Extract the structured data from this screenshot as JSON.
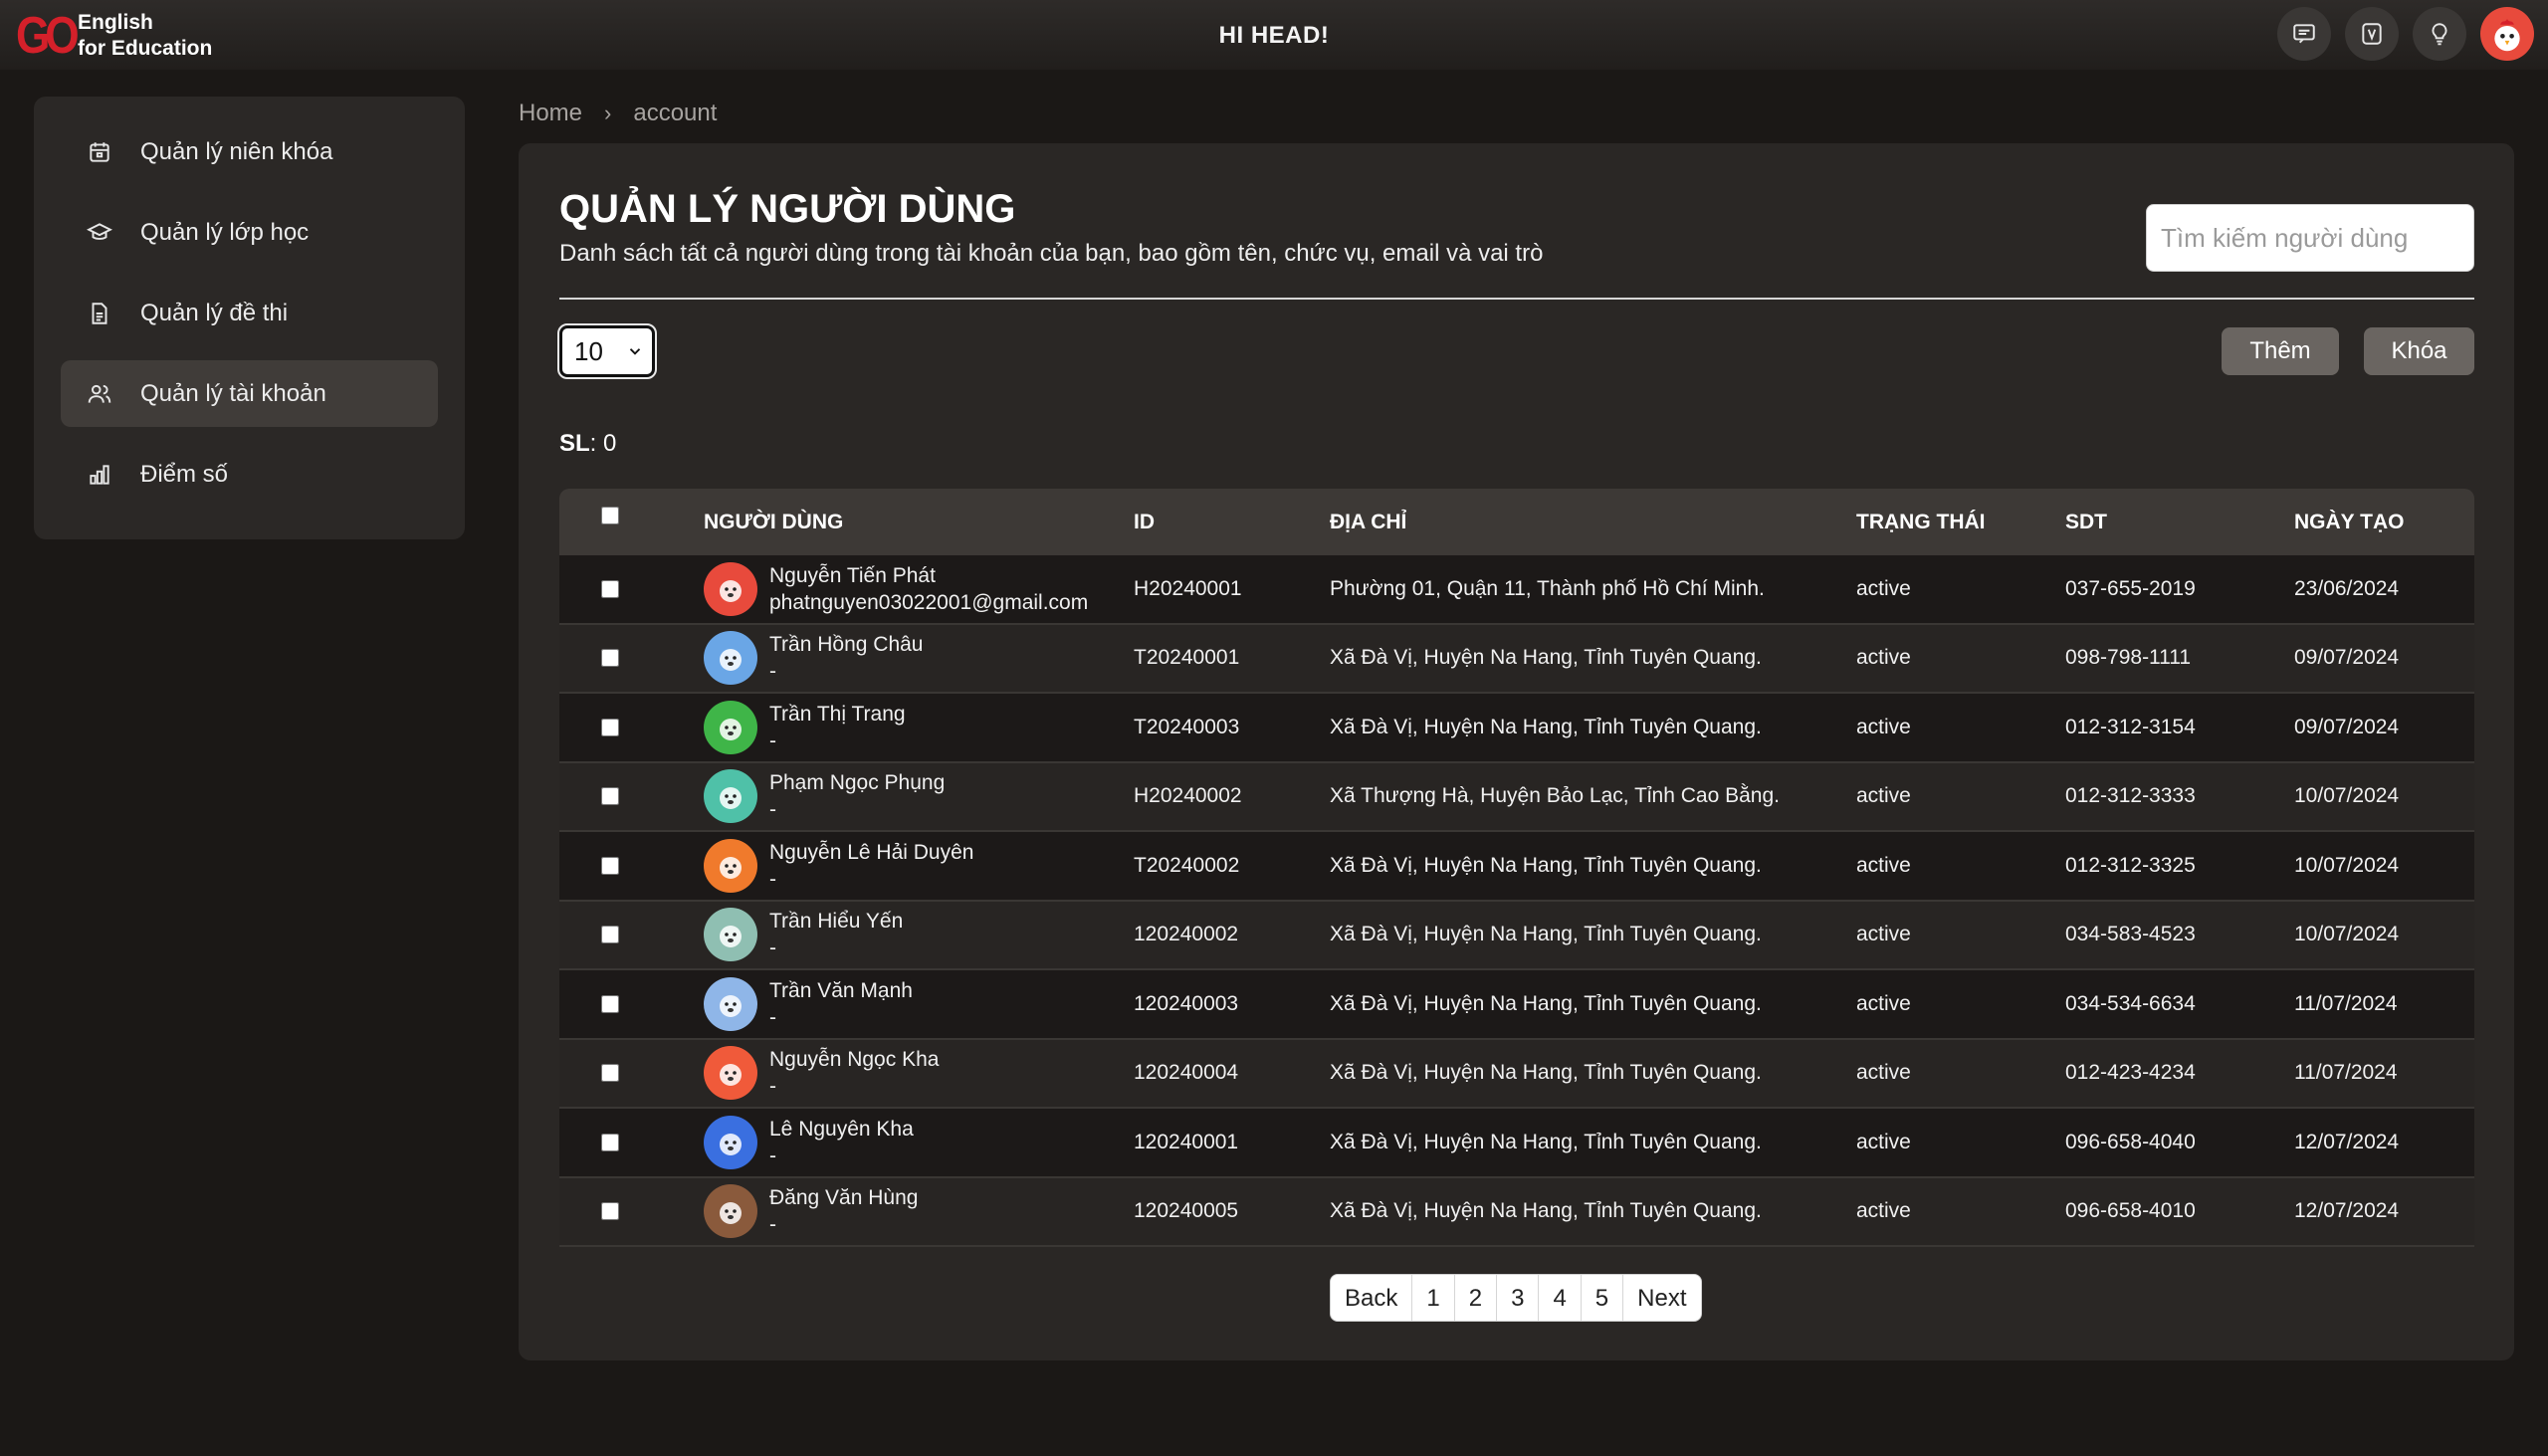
{
  "brand": {
    "mark": "GO",
    "line1": "English",
    "line2": "for Education"
  },
  "header": {
    "title": "HI HEAD!",
    "icons": [
      "chat-icon",
      "v-badge-icon",
      "lightbulb-icon",
      "user-avatar"
    ]
  },
  "sidebar": {
    "items": [
      {
        "label": "Quản lý niên khóa",
        "icon": "calendar-icon"
      },
      {
        "label": "Quản lý lớp học",
        "icon": "graduation-cap-icon"
      },
      {
        "label": "Quản lý đề thi",
        "icon": "document-icon"
      },
      {
        "label": "Quản lý tài khoản",
        "icon": "users-icon",
        "active": true
      },
      {
        "label": "Điểm số",
        "icon": "bar-chart-icon"
      }
    ]
  },
  "breadcrumb": {
    "home": "Home",
    "separator": "›",
    "current": "account"
  },
  "main": {
    "title": "QUẢN LÝ NGƯỜI DÙNG",
    "subtitle": "Danh sách tất cả người dùng trong tài khoản của bạn, bao gồm tên, chức vụ, email và vai trò",
    "search_placeholder": "Tìm kiếm người dùng",
    "page_size": "10",
    "add_label": "Thêm",
    "lock_label": "Khóa",
    "count_label": "SL",
    "count_value": ": 0"
  },
  "table": {
    "columns": [
      "NGƯỜI DÙNG",
      "ID",
      "ĐỊA CHỈ",
      "TRẠNG THÁI",
      "SDT",
      "NGÀY TẠO"
    ],
    "rows": [
      {
        "name": "Nguyễn Tiến Phát",
        "email": "phatnguyen03022001@gmail.com",
        "id": "H20240001",
        "address": "Phường 01, Quận 11, Thành phố Hồ Chí Minh.",
        "status": "active",
        "phone": "037-655-2019",
        "date": "23/06/2024",
        "avatar_color": "#e84a3c"
      },
      {
        "name": "Trần Hồng Châu",
        "email": "-",
        "id": "T20240001",
        "address": "Xã Đà Vị, Huyện Na Hang, Tỉnh Tuyên Quang.",
        "status": "active",
        "phone": "098-798-1111",
        "date": "09/07/2024",
        "avatar_color": "#6aa6e6"
      },
      {
        "name": "Trần Thị Trang",
        "email": "-",
        "id": "T20240003",
        "address": "Xã Đà Vị, Huyện Na Hang, Tỉnh Tuyên Quang.",
        "status": "active",
        "phone": "012-312-3154",
        "date": "09/07/2024",
        "avatar_color": "#3fb548"
      },
      {
        "name": "Phạm Ngọc Phụng",
        "email": "-",
        "id": "H20240002",
        "address": "Xã Thượng Hà, Huyện Bảo Lạc, Tỉnh Cao Bằng.",
        "status": "active",
        "phone": "012-312-3333",
        "date": "10/07/2024",
        "avatar_color": "#4fc1a8"
      },
      {
        "name": "Nguyễn Lê Hải Duyên",
        "email": "-",
        "id": "T20240002",
        "address": "Xã Đà Vị, Huyện Na Hang, Tỉnh Tuyên Quang.",
        "status": "active",
        "phone": "012-312-3325",
        "date": "10/07/2024",
        "avatar_color": "#f07a2c"
      },
      {
        "name": "Trần Hiểu Yến",
        "email": "-",
        "id": "120240002",
        "address": "Xã Đà Vị, Huyện Na Hang, Tỉnh Tuyên Quang.",
        "status": "active",
        "phone": "034-583-4523",
        "date": "10/07/2024",
        "avatar_color": "#8fbfb2"
      },
      {
        "name": "Trần Văn Mạnh",
        "email": "-",
        "id": "120240003",
        "address": "Xã Đà Vị, Huyện Na Hang, Tỉnh Tuyên Quang.",
        "status": "active",
        "phone": "034-534-6634",
        "date": "11/07/2024",
        "avatar_color": "#8fb6e8"
      },
      {
        "name": "Nguyễn Ngọc Kha",
        "email": "-",
        "id": "120240004",
        "address": "Xã Đà Vị, Huyện Na Hang, Tỉnh Tuyên Quang.",
        "status": "active",
        "phone": "012-423-4234",
        "date": "11/07/2024",
        "avatar_color": "#f05a3a"
      },
      {
        "name": "Lê Nguyên Kha",
        "email": "-",
        "id": "120240001",
        "address": "Xã Đà Vị, Huyện Na Hang, Tỉnh Tuyên Quang.",
        "status": "active",
        "phone": "096-658-4040",
        "date": "12/07/2024",
        "avatar_color": "#3a6fe0"
      },
      {
        "name": "Đăng Văn Hùng",
        "email": "-",
        "id": "120240005",
        "address": "Xã Đà Vị, Huyện Na Hang, Tỉnh Tuyên Quang.",
        "status": "active",
        "phone": "096-658-4010",
        "date": "12/07/2024",
        "avatar_color": "#8a5a3c"
      }
    ]
  },
  "pagination": {
    "back": "Back",
    "pages": [
      "1",
      "2",
      "3",
      "4",
      "5"
    ],
    "next": "Next"
  }
}
